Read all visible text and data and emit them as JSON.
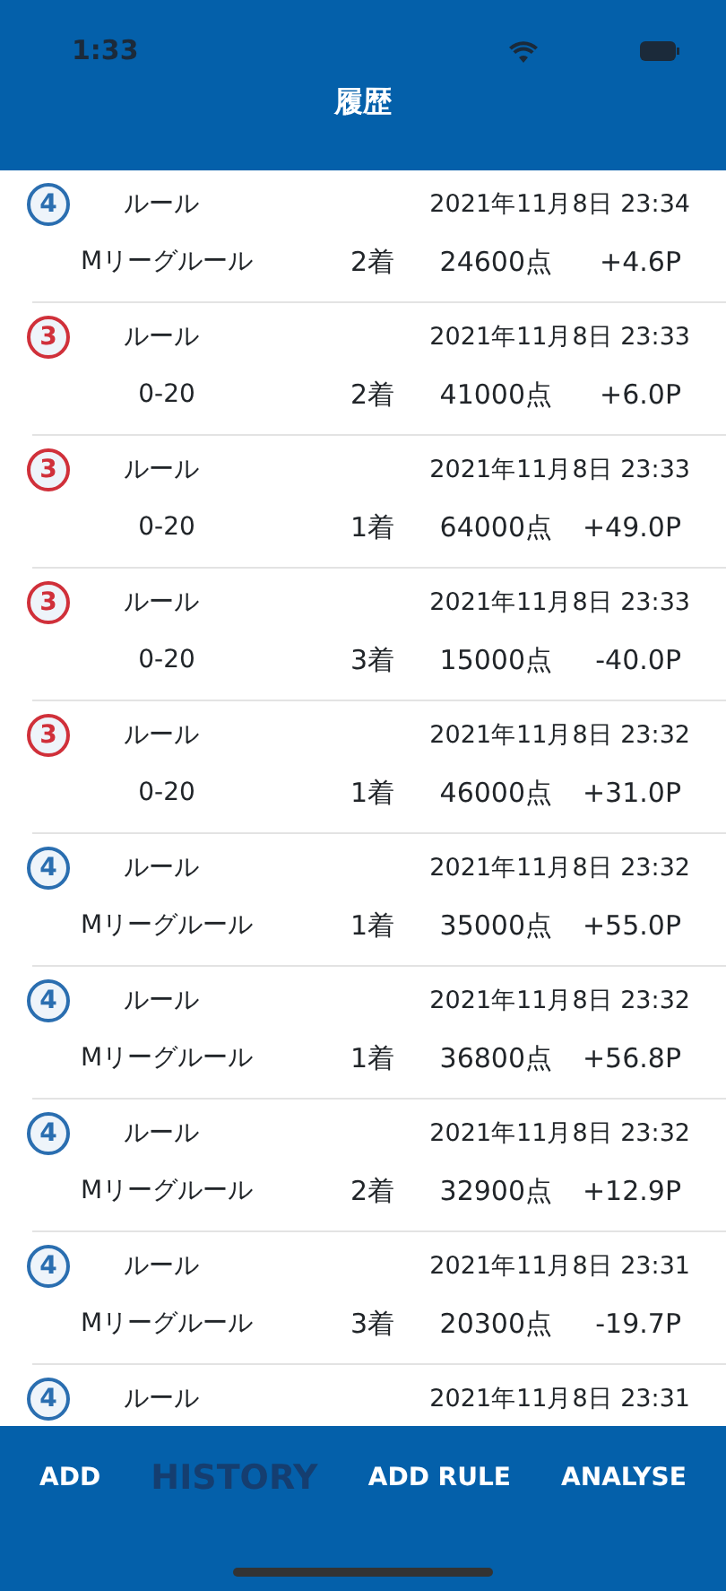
{
  "status_bar": {
    "time": "1:33"
  },
  "header": {
    "title": "履歴"
  },
  "history": [
    {
      "players": "4",
      "color": "#2a6eb0",
      "label": "ルール",
      "date": "2021年11月8日 23:34",
      "rule": "Mリーグルール",
      "rank": "2着",
      "score": "24600点",
      "points": "+4.6P"
    },
    {
      "players": "3",
      "color": "#d0303a",
      "label": "ルール",
      "date": "2021年11月8日 23:33",
      "rule": "0-20",
      "rank": "2着",
      "score": "41000点",
      "points": "+6.0P"
    },
    {
      "players": "3",
      "color": "#d0303a",
      "label": "ルール",
      "date": "2021年11月8日 23:33",
      "rule": "0-20",
      "rank": "1着",
      "score": "64000点",
      "points": "+49.0P"
    },
    {
      "players": "3",
      "color": "#d0303a",
      "label": "ルール",
      "date": "2021年11月8日 23:33",
      "rule": "0-20",
      "rank": "3着",
      "score": "15000点",
      "points": "-40.0P"
    },
    {
      "players": "3",
      "color": "#d0303a",
      "label": "ルール",
      "date": "2021年11月8日 23:32",
      "rule": "0-20",
      "rank": "1着",
      "score": "46000点",
      "points": "+31.0P"
    },
    {
      "players": "4",
      "color": "#2a6eb0",
      "label": "ルール",
      "date": "2021年11月8日 23:32",
      "rule": "Mリーグルール",
      "rank": "1着",
      "score": "35000点",
      "points": "+55.0P"
    },
    {
      "players": "4",
      "color": "#2a6eb0",
      "label": "ルール",
      "date": "2021年11月8日 23:32",
      "rule": "Mリーグルール",
      "rank": "1着",
      "score": "36800点",
      "points": "+56.8P"
    },
    {
      "players": "4",
      "color": "#2a6eb0",
      "label": "ルール",
      "date": "2021年11月8日 23:32",
      "rule": "Mリーグルール",
      "rank": "2着",
      "score": "32900点",
      "points": "+12.9P"
    },
    {
      "players": "4",
      "color": "#2a6eb0",
      "label": "ルール",
      "date": "2021年11月8日 23:31",
      "rule": "Mリーグルール",
      "rank": "3着",
      "score": "20300点",
      "points": "-19.7P"
    },
    {
      "players": "4",
      "color": "#2a6eb0",
      "label": "ルール",
      "date": "2021年11月8日 23:31"
    }
  ],
  "tab_bar": [
    {
      "label": "ADD",
      "selected": false
    },
    {
      "label": "HISTORY",
      "selected": true
    },
    {
      "label": "ADD RULE",
      "selected": false
    },
    {
      "label": "ANALYSE",
      "selected": false
    }
  ]
}
